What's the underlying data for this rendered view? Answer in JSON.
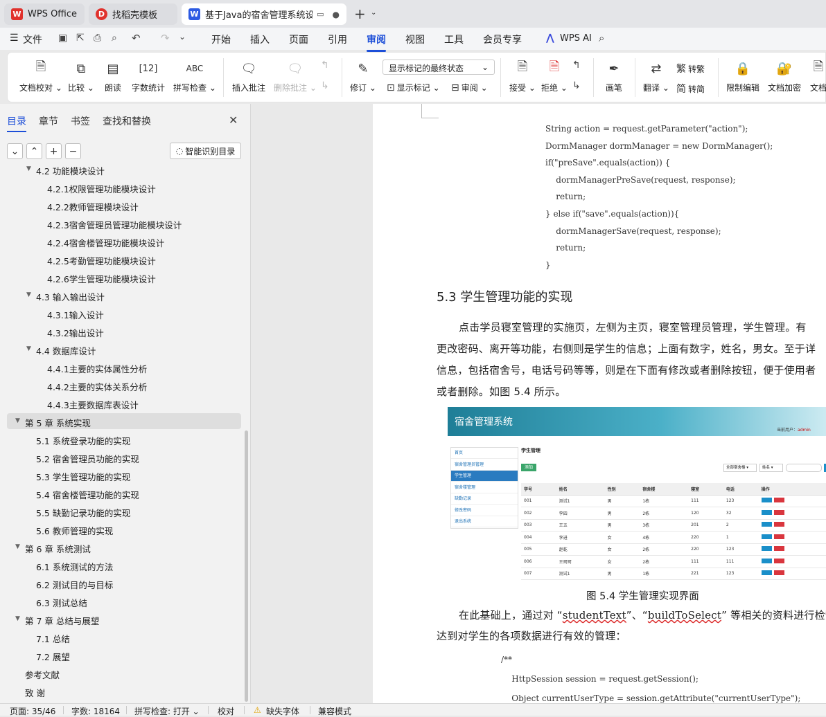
{
  "tabs": [
    {
      "label": "WPS Office",
      "logo": "W"
    },
    {
      "label": "找稻壳模板",
      "logo": "D"
    },
    {
      "label": "基于Java的宿舍管理系统设计与",
      "logo": "W"
    }
  ],
  "new_tab": "+",
  "menu": {
    "file": "文件",
    "items": [
      "开始",
      "插入",
      "页面",
      "引用",
      "审阅",
      "视图",
      "工具",
      "会员专享"
    ],
    "selected": "审阅",
    "wps_ai": "WPS AI"
  },
  "ribbon": {
    "doc_proof": "文档校对",
    "compare": "比较",
    "read": "朗读",
    "word_count": "字数统计",
    "spell_check": "拼写检查",
    "insert_comment": "插入批注",
    "delete_comment": "删除批注",
    "revise": "修订",
    "markup_select": "显示标记的最终状态",
    "show_markup": "显示标记",
    "review": "审阅",
    "accept": "接受",
    "reject": "拒绝",
    "pen": "画笔",
    "translate": "翻译",
    "to_traditional": "转繁",
    "to_simplified": "转简",
    "restrict_edit": "限制编辑",
    "encrypt": "文档加密",
    "doc_more": "文档"
  },
  "nav": {
    "tabs": [
      "目录",
      "章节",
      "书签",
      "查找和替换"
    ],
    "selected": "目录",
    "smart_toc": "智能识别目录",
    "toc": [
      {
        "text": "4.2 功能模块设计",
        "level": 2,
        "expand": true
      },
      {
        "text": "4.2.1权限管理功能模块设计",
        "level": 3
      },
      {
        "text": "4.2.2教师管理模块设计",
        "level": 3
      },
      {
        "text": "4.2.3宿舍管理员管理功能模块设计",
        "level": 3
      },
      {
        "text": "4.2.4宿舍楼管理功能模块设计",
        "level": 3
      },
      {
        "text": "4.2.5考勤管理功能模块设计",
        "level": 3
      },
      {
        "text": "4.2.6学生管理功能模块设计",
        "level": 3
      },
      {
        "text": "4.3 输入输出设计",
        "level": 2,
        "expand": true
      },
      {
        "text": "4.3.1输入设计",
        "level": 3
      },
      {
        "text": "4.3.2输出设计",
        "level": 3
      },
      {
        "text": "4.4 数据库设计",
        "level": 2,
        "expand": true
      },
      {
        "text": "4.4.1主要的实体属性分析",
        "level": 3
      },
      {
        "text": "4.4.2主要的实体关系分析",
        "level": 3
      },
      {
        "text": "4.4.3主要数据库表设计",
        "level": 3
      },
      {
        "text": "第 5 章  系统实现",
        "level": 1,
        "expand": true,
        "active": true
      },
      {
        "text": "5.1 系统登录功能的实现",
        "level": 2
      },
      {
        "text": "5.2 宿舍管理员功能的实现",
        "level": 2
      },
      {
        "text": "5.3 学生管理功能的实现",
        "level": 2
      },
      {
        "text": "5.4 宿舍楼管理功能的实现",
        "level": 2
      },
      {
        "text": "5.5 缺勤记录功能的实现",
        "level": 2
      },
      {
        "text": "5.6 教师管理的实现",
        "level": 2
      },
      {
        "text": "第 6 章  系统测试",
        "level": 1,
        "expand": true
      },
      {
        "text": "6.1 系统测试的方法",
        "level": 2
      },
      {
        "text": "6.2 测试目的与目标",
        "level": 2
      },
      {
        "text": "6.3 测试总结",
        "level": 2
      },
      {
        "text": "第 7 章  总结与展望",
        "level": 1,
        "expand": true
      },
      {
        "text": "7.1 总结",
        "level": 2
      },
      {
        "text": "7.2 展望",
        "level": 2
      },
      {
        "text": "参考文献",
        "level": 1
      },
      {
        "text": "致  谢",
        "level": 1
      }
    ]
  },
  "doc": {
    "code1": [
      "String action = request.getParameter(\"action\");",
      "DormManager dormManager = new DormManager();",
      "if(\"preSave\".equals(action)) {",
      "    dormManagerPreSave(request, response);",
      "    return;",
      "} else if(\"save\".equals(action)){",
      "    dormManagerSave(request, response);",
      "    return;",
      "}"
    ],
    "heading": "5.3 学生管理功能的实现",
    "para1": [
      "点击学员寝室管理的实施页，左侧为主页，寝室管理员管理，学生管理。有",
      "更改密码、离开等功能，右侧则是学生的信息；上面有数字，姓名，男女。至于详",
      "信息，包括宿舍号，电话号码等等，则是在下面有修改或者删除按钮，便于使用者",
      "或者删除。如图 5.4 所示。"
    ],
    "caption": "图 5.4 学生管理实现界面",
    "para2_pre": "在此基础上，通过对 “",
    "para2_t1": "studentText",
    "para2_mid": "”、“",
    "para2_t2": "buildToSelect",
    "para2_post": "” 等相关的资料进行检索，",
    "para2_line2": "达到对学生的各项数据进行有效的管理：",
    "code2": [
      "/**",
      "    HttpSession session = request.getSession();",
      "    Object currentUserType = session.getAttribute(\"currentUserType\");"
    ]
  },
  "screenshot": {
    "title": "宿舍管理系统",
    "user_label": "当前用户：",
    "user_value": "admin",
    "menu": [
      "首页",
      "宿舍管理员管理",
      "学生管理",
      "宿舍楼管理",
      "缺勤记录",
      "修改密码",
      "退出系统"
    ],
    "menu_selected": "学生管理",
    "section": "学生管理",
    "add_btn": "添加",
    "filter": "全部宿舍楼",
    "filter2": "姓名",
    "columns": [
      "学号",
      "姓名",
      "性别",
      "宿舍楼",
      "寝室",
      "电话",
      "操作"
    ],
    "rows": [
      [
        "001",
        "测试1",
        "男",
        "1栋",
        "111",
        "123"
      ],
      [
        "002",
        "李四",
        "男",
        "2栋",
        "120",
        "32"
      ],
      [
        "003",
        "王五",
        "男",
        "3栋",
        "201",
        "2"
      ],
      [
        "004",
        "李进",
        "女",
        "4栋",
        "220",
        "1"
      ],
      [
        "005",
        "赵乾",
        "女",
        "2栋",
        "220",
        "123"
      ],
      [
        "006",
        "王珂珂",
        "女",
        "2栋",
        "111",
        "111"
      ],
      [
        "007",
        "测试1",
        "男",
        "1栋",
        "221",
        "123"
      ]
    ]
  },
  "status": {
    "page": "页面: 35/46",
    "words": "字数: 18164",
    "spell": "拼写检查: 打开",
    "proof": "校对",
    "missing_font": "缺失字体",
    "compat": "兼容模式"
  },
  "colors": {
    "accent": "#1d4fd8",
    "wps_red": "#e0312c"
  }
}
